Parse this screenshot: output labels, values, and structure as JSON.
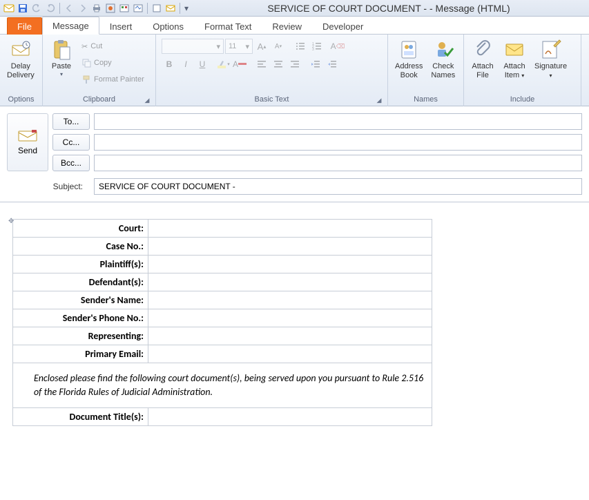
{
  "window_title": "SERVICE OF COURT DOCUMENT -  - Message (HTML)",
  "tabs": {
    "file": "File",
    "message": "Message",
    "insert": "Insert",
    "options": "Options",
    "format_text": "Format Text",
    "review": "Review",
    "developer": "Developer"
  },
  "ribbon": {
    "options_group": "Options",
    "delay_delivery": "Delay\nDelivery",
    "clipboard_group": "Clipboard",
    "paste": "Paste",
    "cut": "Cut",
    "copy": "Copy",
    "format_painter": "Format Painter",
    "basic_text_group": "Basic Text",
    "font_size": "11",
    "names_group": "Names",
    "address_book": "Address\nBook",
    "check_names": "Check\nNames",
    "include_group": "Include",
    "attach_file": "Attach\nFile",
    "attach_item": "Attach\nItem",
    "signature": "Signature"
  },
  "header": {
    "send": "Send",
    "to": "To...",
    "cc": "Cc...",
    "bcc": "Bcc...",
    "subject_label": "Subject:",
    "subject_value": "SERVICE OF COURT DOCUMENT -"
  },
  "body": {
    "rows": [
      "Court:",
      "Case No.:",
      "Plaintiff(s):",
      "Defendant(s):",
      "Sender's Name:",
      "Sender's Phone No.:",
      "Representing:",
      "Primary Email:"
    ],
    "message_para": "Enclosed please find  the following court document(s), being served upon you pursuant to Rule 2.516 of the Florida Rules of Judicial Administration.",
    "doc_title": "Document Title(s):"
  }
}
